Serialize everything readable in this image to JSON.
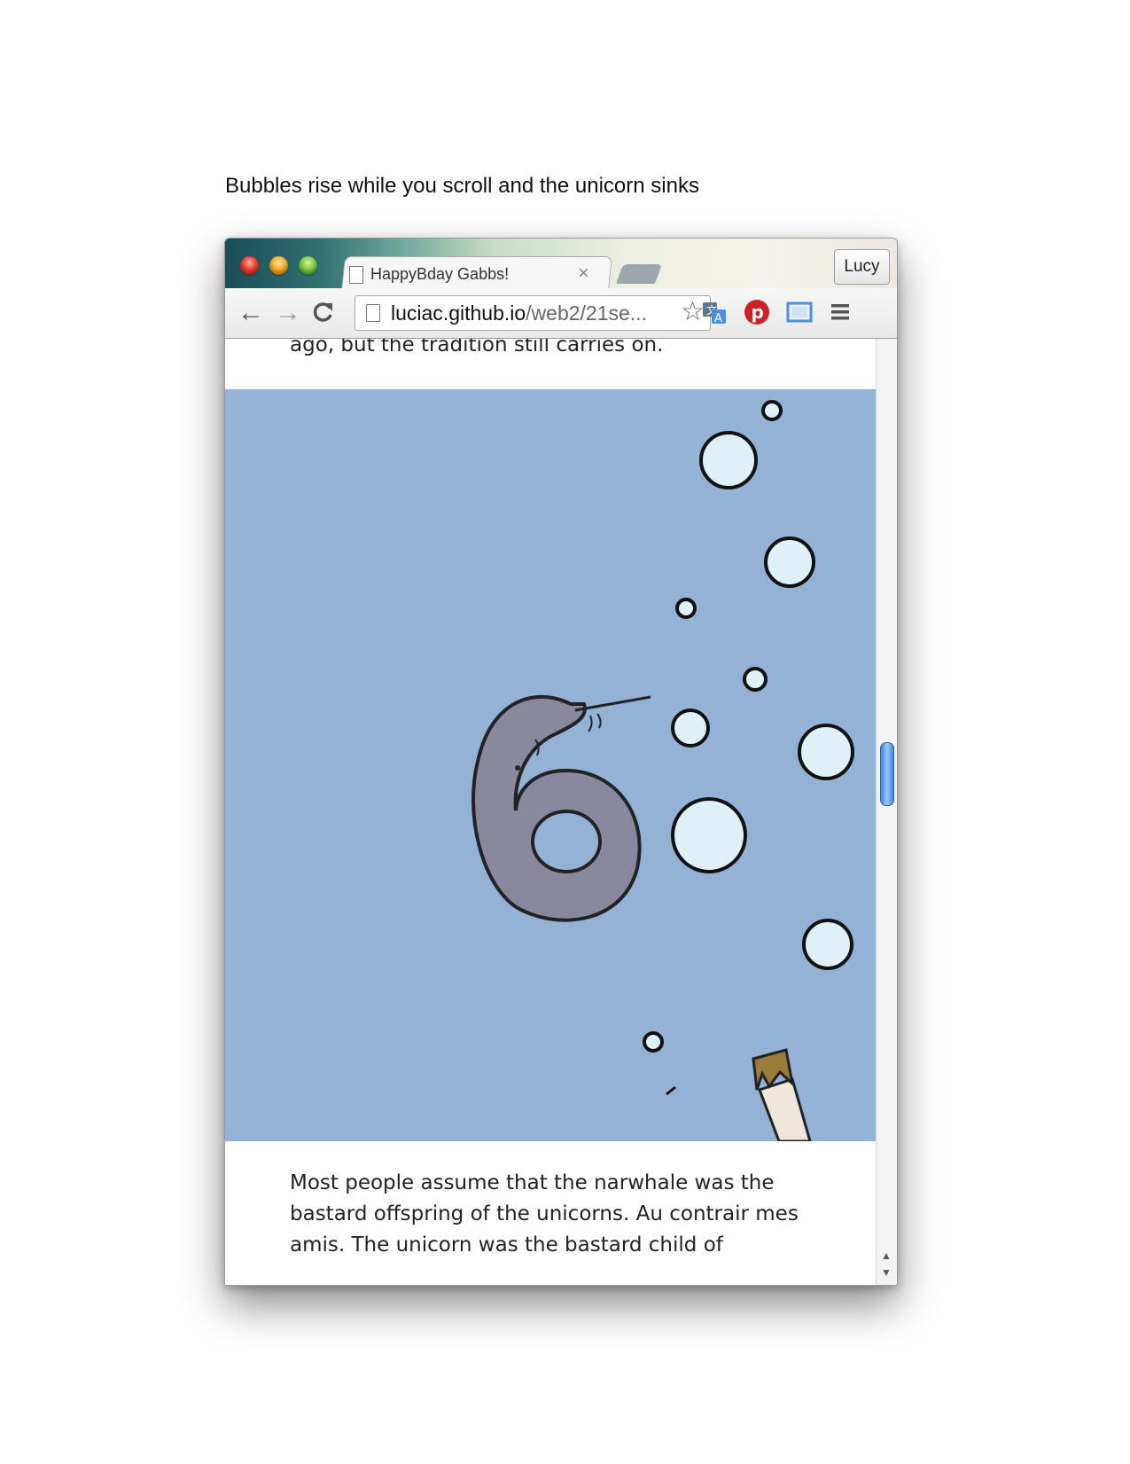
{
  "caption": "Bubbles rise while you scroll and the unicorn sinks",
  "browser": {
    "tab": {
      "title": "HappyBday Gabbs!",
      "close": "×"
    },
    "profile": "Lucy",
    "address": {
      "host": "luciac.github.io",
      "path": "/web2/21se..."
    },
    "icons": [
      "back-icon",
      "forward-icon",
      "reload-icon",
      "page-icon",
      "star-icon",
      "translate-icon",
      "pinterest-icon",
      "fullscreen-icon",
      "menu-icon"
    ]
  },
  "page": {
    "top_text": "ago, but the tradition still carries on.",
    "body_lines": [
      "Most people assume that the narwhale was the",
      "bastard offspring of the unicorns. Au contrair mes",
      "amis. The unicorn was the bastard child of"
    ],
    "ocean_color": "#93b2d6",
    "bubble_color": "#dff0f7"
  }
}
